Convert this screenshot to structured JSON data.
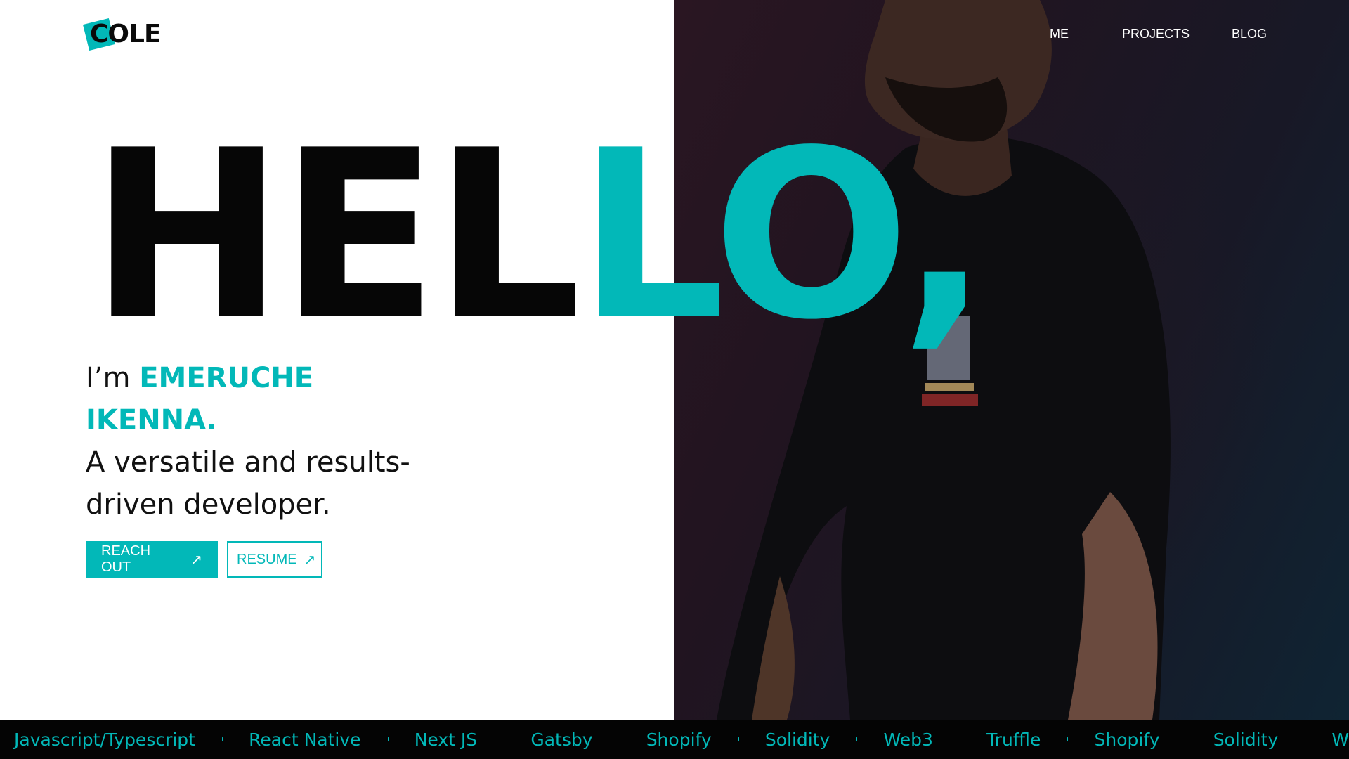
{
  "brand": {
    "logo_text": "COLE",
    "accent_color": "#02b8b8"
  },
  "nav": {
    "items": [
      "ME",
      "PROJECTS",
      "BLOG"
    ]
  },
  "hero": {
    "greeting_dark": "HEL",
    "greeting_accent": "LO,",
    "intro_prefix": "I’m ",
    "name": "EMERUCHE IKENNA.",
    "tagline": "A versatile and results-driven developer.",
    "photo_icon": "portrait-photo"
  },
  "actions": {
    "reach_out_label": "REACH OUT",
    "resume_label": "RESUME",
    "arrow_glyph": "↗"
  },
  "ticker": {
    "items": [
      "Javascript/Typescript",
      "React Native",
      "Next JS",
      "Gatsby",
      "Shopify",
      "Solidity",
      "Web3",
      "Truffle",
      "Shopify",
      "Solidity",
      "W"
    ]
  }
}
